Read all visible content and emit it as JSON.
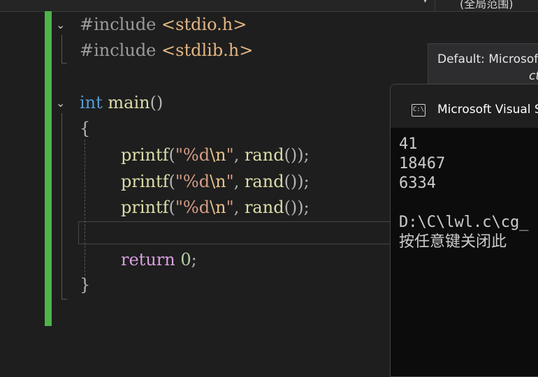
{
  "toolbar": {
    "dropdown_icon": "chevron-down-icon",
    "scope_label": "(全局范围)"
  },
  "code_lines": [
    {
      "directive": "#include",
      "header": "<stdio.h>"
    },
    {
      "directive": "#include",
      "header": "<stdlib.h>"
    },
    {
      "type": "int",
      "func": "main",
      "parens": "()"
    },
    {
      "text": "{"
    },
    {
      "func": "printf",
      "open": "(",
      "fmt": "\"%d",
      "esc": "\\n",
      "close_str": "\"",
      "comma": ", ",
      "call": "rand",
      "tail": "());"
    },
    {
      "func": "printf",
      "open": "(",
      "fmt": "\"%d",
      "esc": "\\n",
      "close_str": "\"",
      "comma": ", ",
      "call": "rand",
      "tail": "());"
    },
    {
      "func": "printf",
      "open": "(",
      "fmt": "\"%d",
      "esc": "\\n",
      "close_str": "\"",
      "comma": ", ",
      "call": "rand",
      "tail": "());"
    },
    {
      "text": ""
    },
    {
      "keyword": "return",
      "value": "0",
      "semi": ";"
    },
    {
      "text": "}"
    }
  ],
  "tooltip": {
    "line1": "Default: Microsoft",
    "line2": "ct"
  },
  "console": {
    "title": "Microsoft Visual S",
    "icon_text": "C:\\",
    "output": [
      "41",
      "18467",
      "6334",
      "",
      "D:\\C\\lwl.c\\cg_",
      "按任意键关闭此"
    ]
  },
  "colors": {
    "change_bar": "#4fb34a",
    "keyword_type": "#569cd6",
    "function": "#dcdcaa",
    "string": "#d69d85",
    "control_keyword": "#d8a0df",
    "number": "#b5cea8"
  }
}
